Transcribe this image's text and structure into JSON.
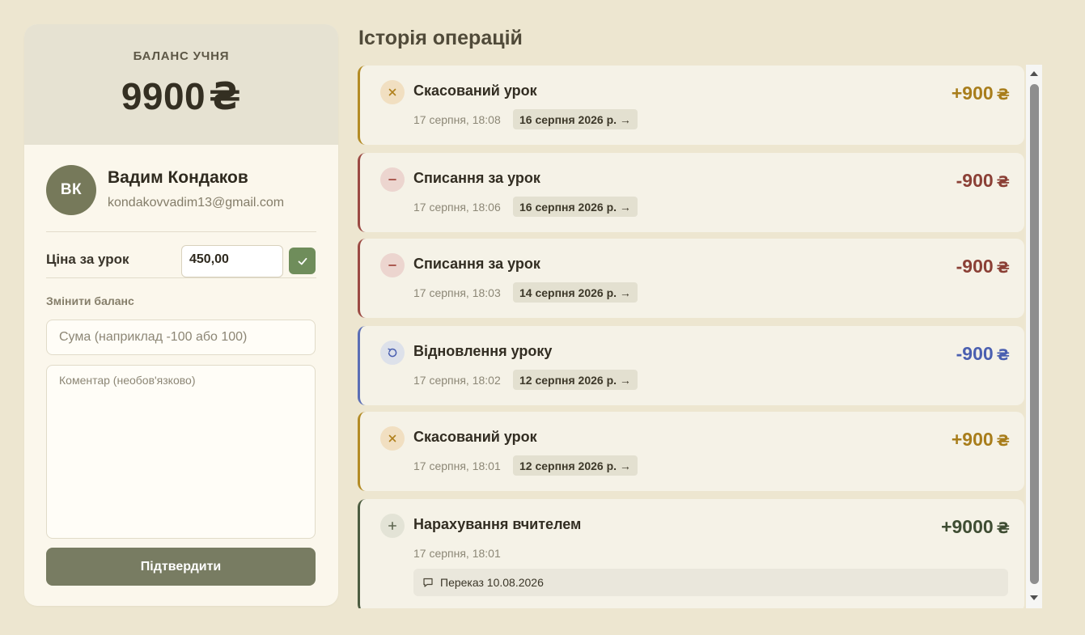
{
  "balance": {
    "label": "БАЛАНС УЧНЯ",
    "amount": "9900",
    "currency": "₴"
  },
  "student": {
    "initials": "ВК",
    "name": "Вадим Кондаков",
    "email": "kondakovvadim13@gmail.com"
  },
  "price": {
    "label": "Ціна за урок",
    "value": "450,00"
  },
  "change_balance": {
    "label": "Змінити баланс",
    "amount_placeholder": "Сума (наприклад -100 або 100)",
    "comment_placeholder": "Коментар (необов'язково)",
    "confirm_label": "Підтвердити"
  },
  "history": {
    "title": "Історія операцій",
    "currency": "₴",
    "items": [
      {
        "type": "cancel",
        "icon": "x-icon",
        "title": "Скасований урок",
        "time": "17 серпня, 18:08",
        "lesson": "16 серпня 2026 р. →",
        "amount": "+900"
      },
      {
        "type": "charge",
        "icon": "minus-icon",
        "title": "Списання за урок",
        "time": "17 серпня, 18:06",
        "lesson": "16 серпня 2026 р. →",
        "amount": "-900"
      },
      {
        "type": "charge",
        "icon": "minus-icon",
        "title": "Списання за урок",
        "time": "17 серпня, 18:03",
        "lesson": "14 серпня 2026 р. →",
        "amount": "-900"
      },
      {
        "type": "restore",
        "icon": "restore-icon",
        "title": "Відновлення уроку",
        "time": "17 серпня, 18:02",
        "lesson": "12 серпня 2026 р. →",
        "amount": "-900"
      },
      {
        "type": "cancel",
        "icon": "x-icon",
        "title": "Скасований урок",
        "time": "17 серпня, 18:01",
        "lesson": "12 серпня 2026 р. →",
        "amount": "+900"
      },
      {
        "type": "deposit",
        "icon": "plus-icon",
        "title": "Нарахування вчителем",
        "time": "17 серпня, 18:01",
        "note": "Переказ 10.08.2026",
        "amount": "+9000"
      }
    ]
  },
  "colors": {
    "cancel": "#b38b25",
    "charge": "#9b4a43",
    "restore": "#5b6eb5",
    "deposit": "#4c5c40",
    "accent_button": "#787c62",
    "ok_button": "#6f8d5b"
  }
}
